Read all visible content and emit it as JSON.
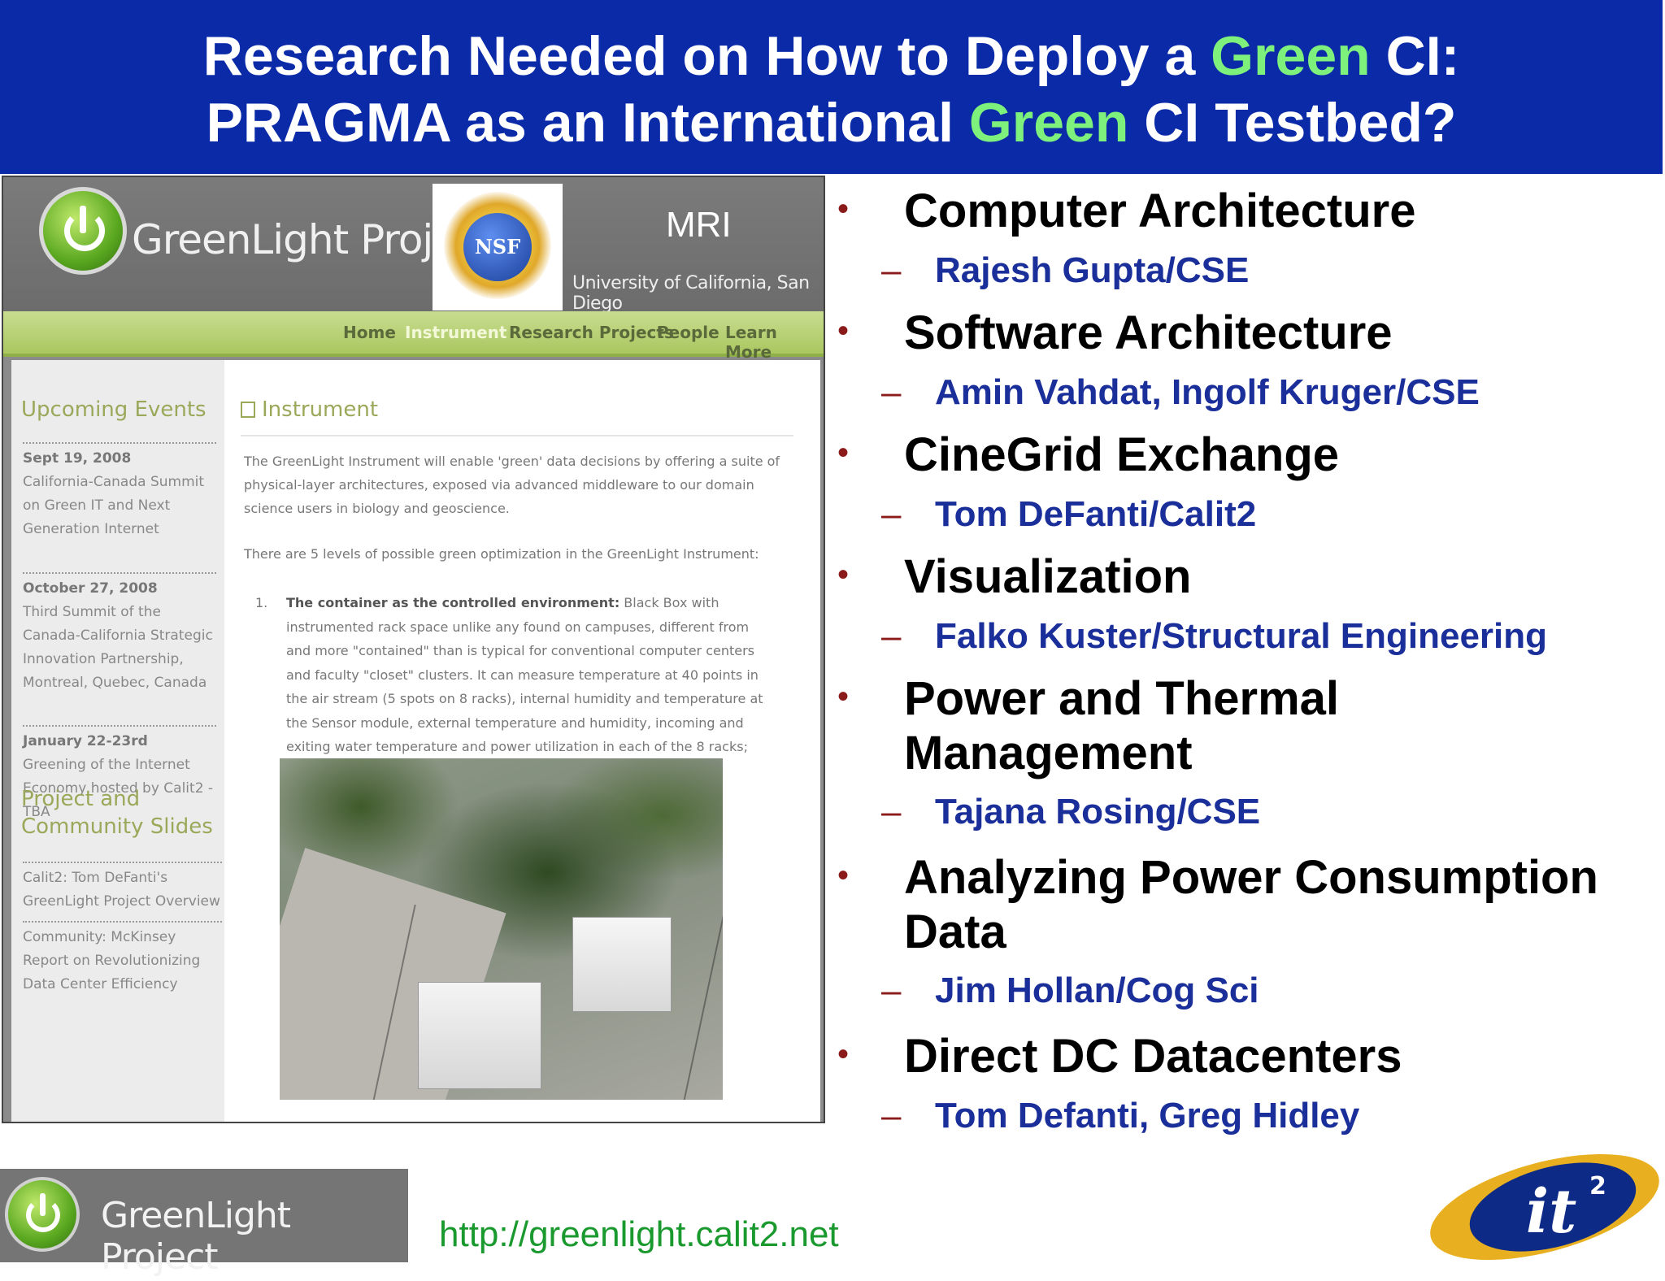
{
  "title": {
    "line1_a": "Research Needed on How to Deploy a ",
    "line1_green": "Green",
    "line1_b": " CI:",
    "line2_a": "PRAGMA as an International ",
    "line2_green": "Green",
    "line2_b": " CI Testbed?"
  },
  "screenshot": {
    "site_title": "GreenLight Project",
    "nsf_label": "NSF",
    "mri": "MRI",
    "ucsd": "University of California, San Diego",
    "nav": [
      "Home",
      "Instrument",
      "Research Projects",
      "People",
      "Learn More"
    ],
    "sidebar": {
      "events_heading": "Upcoming Events",
      "events": [
        {
          "date": "Sept 19, 2008",
          "text": "California-Canada Summit on Green IT and Next Generation Internet"
        },
        {
          "date": "October 27, 2008",
          "text": "Third Summit of the Canada-California Strategic Innovation Partnership, Montreal, Quebec, Canada"
        },
        {
          "date": "January 22-23rd",
          "text": "Greening of the Internet Economy hosted by Calit2 - TBA"
        }
      ],
      "slides_heading": "Project and Community Slides",
      "slides": [
        "Calit2: Tom DeFanti's GreenLight Project Overview",
        "Community: McKinsey Report on Revolutionizing Data Center Efficiency"
      ]
    },
    "content": {
      "heading": "Instrument",
      "para1": "The GreenLight Instrument will enable 'green' data decisions by offering a suite of physical-layer architectures, exposed via advanced middleware to our domain science users in biology and geoscience.",
      "para2": "There are 5 levels of possible green optimization in the GreenLight Instrument:",
      "item_number": "1.",
      "item_bold": "The container as the controlled environment:",
      "item_text": " Black Box with instrumented rack space unlike any found on campuses, different from and more \"contained\" than is typical for conventional computer centers and faculty \"closet\" clusters. It can measure temperature at 40 points in the air stream (5 spots on 8 racks), internal humidity and temperature at the Sensor module, external temperature and humidity, incoming and exiting water temperature and power utilization in each of the 8 racks;"
    }
  },
  "bullets": [
    {
      "label": "Computer Architecture",
      "sub": "Rajesh Gupta/CSE"
    },
    {
      "label": "Software Architecture",
      "sub": "Amin Vahdat, Ingolf Kruger/CSE"
    },
    {
      "label": "CineGrid Exchange",
      "sub": "Tom DeFanti/Calit2"
    },
    {
      "label": "Visualization",
      "sub": "Falko Kuster/Structural Engineering"
    },
    {
      "label": "Power and Thermal Management",
      "sub": "Tajana Rosing/CSE"
    },
    {
      "label": "Analyzing Power Consumption Data",
      "sub": "Jim Hollan/Cog Sci"
    },
    {
      "label": "Direct DC Datacenters",
      "sub": "Tom Defanti, Greg Hidley"
    }
  ],
  "bullet_symbol": "•",
  "dash_symbol": "–",
  "footer": {
    "logo_text": "GreenLight Project",
    "url": "http://greenlight.calit2.net",
    "it2_label": "it",
    "it2_sup": "2"
  },
  "colors": {
    "title_band": "#0a2aa8",
    "title_green": "#7ef07c",
    "sub_blue": "#1a2f9a",
    "bullet_red": "#8b1a1a",
    "url_green": "#1a9a2e"
  },
  "icons": [
    "power-icon",
    "nsf-seal-icon",
    "it2-logo"
  ]
}
